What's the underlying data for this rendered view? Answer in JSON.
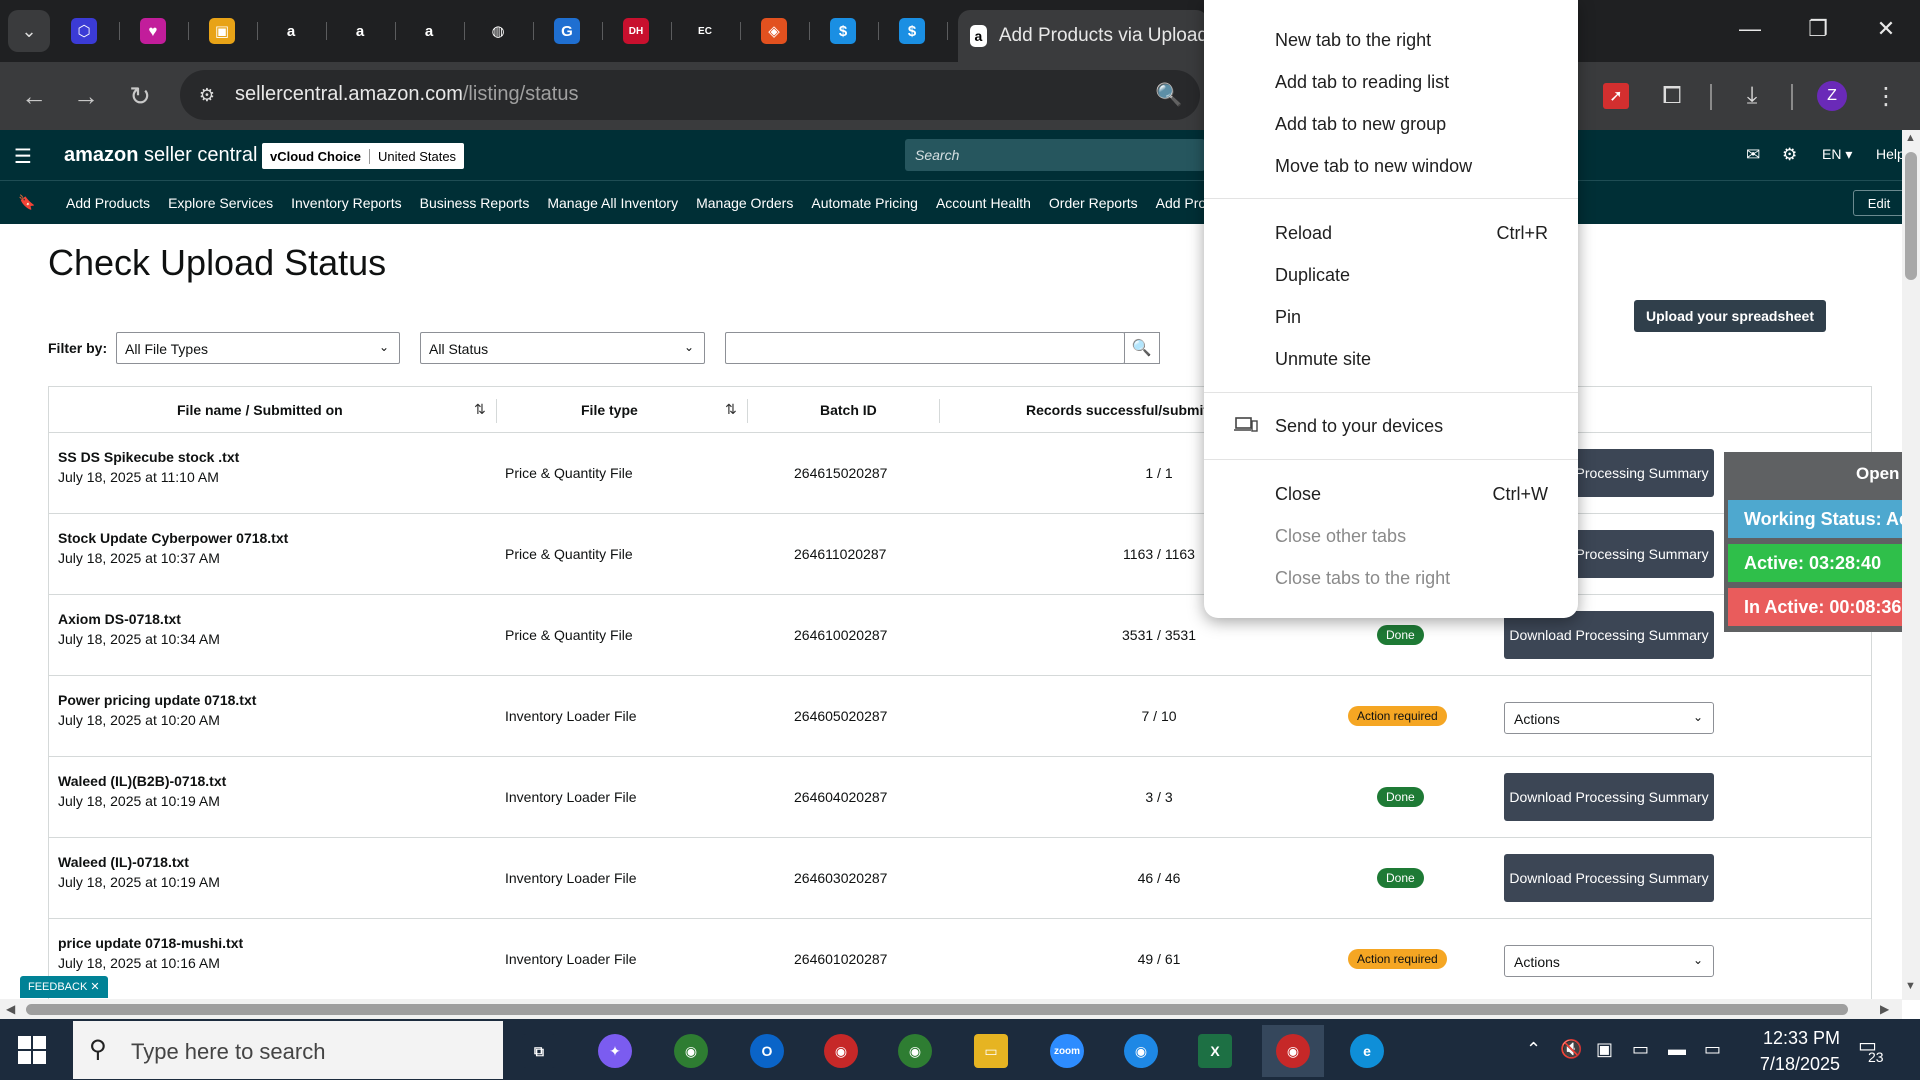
{
  "browser": {
    "active_tab_title": "Add Products via Upload",
    "url_host": "sellercentral.amazon.com",
    "url_path": "/listing/status",
    "pinned_tabs": [
      {
        "icon": "box-icon",
        "color": "#3b3bd6",
        "glyph": "⬡"
      },
      {
        "icon": "heart-app-icon",
        "color": "#c21d9b",
        "glyph": "♥"
      },
      {
        "icon": "package-icon",
        "color": "#e8a317",
        "glyph": "▣"
      },
      {
        "icon": "amazon-icon",
        "color": "#1f2022",
        "glyph": "a"
      },
      {
        "icon": "amazon-icon",
        "color": "#1f2022",
        "glyph": "a"
      },
      {
        "icon": "amazon-icon",
        "color": "#1f2022",
        "glyph": "a"
      },
      {
        "icon": "globe-icon",
        "color": "#1f2022",
        "glyph": "◍"
      },
      {
        "icon": "g-app-icon",
        "color": "#1f6fd1",
        "glyph": "G"
      },
      {
        "icon": "dh-icon",
        "color": "#c8102e",
        "glyph": "DH"
      },
      {
        "icon": "ec-icon",
        "color": "#1f2022",
        "glyph": "EC"
      },
      {
        "icon": "layers-icon",
        "color": "#e2511f",
        "glyph": "◈"
      },
      {
        "icon": "dollar-icon",
        "color": "#1a8fe3",
        "glyph": "$"
      },
      {
        "icon": "dollar-icon",
        "color": "#1a8fe3",
        "glyph": "$"
      }
    ]
  },
  "header": {
    "logo_brand": "amazon",
    "logo_suffix": "seller central",
    "store_name": "vCloud Choice",
    "store_country": "United States",
    "search_placeholder": "Search",
    "language": "EN",
    "help": "Help"
  },
  "nav": {
    "items": [
      "Add Products",
      "Explore Services",
      "Inventory Reports",
      "Business Reports",
      "Manage All Inventory",
      "Manage Orders",
      "Automate Pricing",
      "Account Health",
      "Order Reports",
      "Add Products via Upload"
    ],
    "edit": "Edit"
  },
  "page": {
    "title": "Check Upload Status",
    "upload_button": "Upload your spreadsheet",
    "filter_label": "Filter by:",
    "file_type_filter": "All File Types",
    "status_filter": "All Status"
  },
  "table": {
    "headers": {
      "file": "File name / Submitted on",
      "type": "File type",
      "batch": "Batch ID",
      "records": "Records successful/submitted"
    },
    "rows": [
      {
        "name": "SS DS Spikecube stock .txt",
        "date": "July 18, 2025 at 11:10 AM",
        "type": "Price & Quantity File",
        "batch": "264615020287",
        "records": "1 / 1",
        "status": "",
        "action": "Download Processing Summary"
      },
      {
        "name": "Stock Update Cyberpower 0718.txt",
        "date": "July 18, 2025 at 10:37 AM",
        "type": "Price & Quantity File",
        "batch": "264611020287",
        "records": "1163 / 1163",
        "status": "",
        "action": "Download Processing Summary"
      },
      {
        "name": "Axiom DS-0718.txt",
        "date": "July 18, 2025 at 10:34 AM",
        "type": "Price & Quantity File",
        "batch": "264610020287",
        "records": "3531 / 3531",
        "status": "Done",
        "action": "Download Processing Summary"
      },
      {
        "name": "Power pricing update 0718.txt",
        "date": "July 18, 2025 at 10:20 AM",
        "type": "Inventory Loader File",
        "batch": "264605020287",
        "records": "7 / 10",
        "status": "Action required",
        "action": "Actions"
      },
      {
        "name": "Waleed (IL)(B2B)-0718.txt",
        "date": "July 18, 2025 at 10:19 AM",
        "type": "Inventory Loader File",
        "batch": "264604020287",
        "records": "3 / 3",
        "status": "Done",
        "action": "Download Processing Summary"
      },
      {
        "name": "Waleed (IL)-0718.txt",
        "date": "July 18, 2025 at 10:19 AM",
        "type": "Inventory Loader File",
        "batch": "264603020287",
        "records": "46 / 46",
        "status": "Done",
        "action": "Download Processing Summary"
      },
      {
        "name": "price update 0718-mushi.txt",
        "date": "July 18, 2025 at 10:16 AM",
        "type": "Inventory Loader File",
        "batch": "264601020287",
        "records": "49 / 61",
        "status": "Action required",
        "action": "Actions"
      }
    ]
  },
  "work_status": {
    "open": "Open App",
    "working": "Working Status: Active",
    "active": "Active: 03:28:40",
    "inactive": "In Active: 00:08:36"
  },
  "context_menu": {
    "new_tab_right": "New tab to the right",
    "reading_list": "Add tab to reading list",
    "new_group": "Add tab to new group",
    "move_window": "Move tab to new window",
    "reload": "Reload",
    "reload_shortcut": "Ctrl+R",
    "duplicate": "Duplicate",
    "pin": "Pin",
    "unmute": "Unmute site",
    "send_devices": "Send to your devices",
    "close": "Close",
    "close_shortcut": "Ctrl+W",
    "close_others": "Close other tabs",
    "close_right": "Close tabs to the right"
  },
  "feedback": "FEEDBACK",
  "taskbar": {
    "search_placeholder": "Type here to search",
    "time": "12:33 PM",
    "date": "7/18/2025",
    "notification_count": "23",
    "apps": [
      {
        "name": "task-view-icon",
        "color": "#1c2b3d",
        "glyph": "⧉"
      },
      {
        "name": "copilot-icon",
        "color": "#7b5cf0",
        "glyph": "✦"
      },
      {
        "name": "chrome-icon",
        "color": "#2e7d32",
        "glyph": "◉"
      },
      {
        "name": "outlook-icon",
        "color": "#0a64c8",
        "glyph": "O"
      },
      {
        "name": "chrome-icon",
        "color": "#c62828",
        "glyph": "◉"
      },
      {
        "name": "chrome-icon",
        "color": "#2e7d32",
        "glyph": "◉"
      },
      {
        "name": "file-explorer-icon",
        "color": "#e6b422",
        "glyph": "▭"
      },
      {
        "name": "zoom-icon",
        "color": "#2d8cff",
        "glyph": "zoom"
      },
      {
        "name": "chrome-icon",
        "color": "#1e88e5",
        "glyph": "◉"
      },
      {
        "name": "excel-icon",
        "color": "#1d7044",
        "glyph": "X"
      },
      {
        "name": "chrome-icon",
        "color": "#c62828",
        "glyph": "◉"
      },
      {
        "name": "edge-icon",
        "color": "#0f8fd8",
        "glyph": "e"
      }
    ]
  }
}
